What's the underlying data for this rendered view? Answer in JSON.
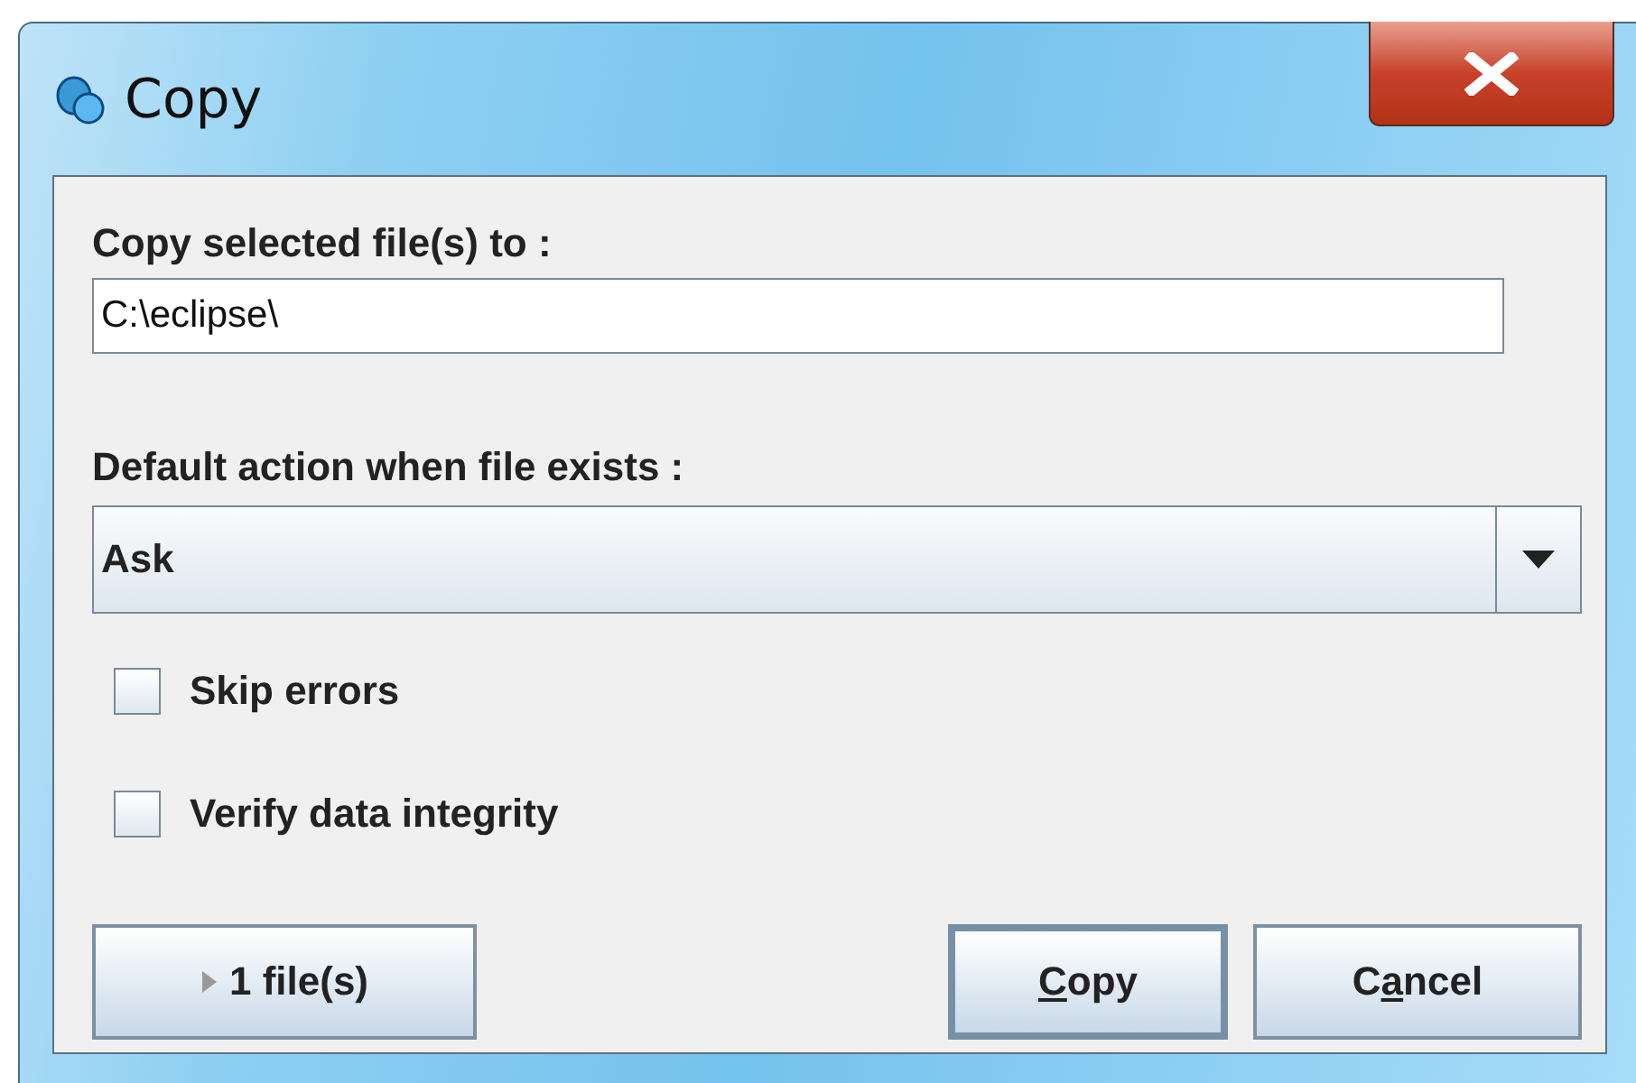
{
  "window": {
    "title": "Copy"
  },
  "destination": {
    "label": "Copy selected file(s) to :",
    "value": "C:\\eclipse\\"
  },
  "default_action": {
    "label": "Default action when file exists :",
    "value": "Ask"
  },
  "options": [
    {
      "label": "Skip errors",
      "checked": false
    },
    {
      "label": "Verify data integrity",
      "checked": false
    }
  ],
  "details_button": {
    "label": "1 file(s)",
    "expanded": false
  },
  "buttons": [
    {
      "mnemonic": "C",
      "label_after": "opy",
      "default": true
    },
    {
      "label_before": "C",
      "mnemonic": "a",
      "label_after": "ncel",
      "default": false
    }
  ]
}
